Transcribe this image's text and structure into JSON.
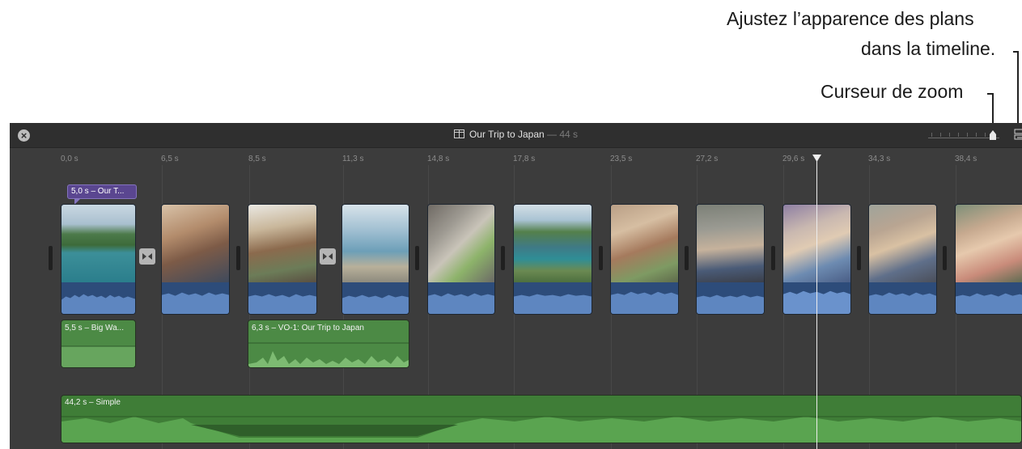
{
  "annotations": {
    "appearance_line1": "Ajustez l’apparence des plans",
    "appearance_line2": "dans la timeline.",
    "zoom": "Curseur de zoom"
  },
  "titlebar": {
    "project_title": "Our Trip to Japan",
    "duration": "— 44 s"
  },
  "ruler": [
    "0,0 s",
    "6,5 s",
    "8,5 s",
    "11,3 s",
    "14,8 s",
    "17,8 s",
    "23,5 s",
    "27,2 s",
    "29,6 s",
    "34,3 s",
    "38,4 s"
  ],
  "title_clip": {
    "label": "5,0 s – Our T..."
  },
  "audio_clips": {
    "sound_effect": "5,5 s – Big Wa...",
    "voiceover": "6,3 s – VO-1: Our Trip to Japan",
    "music": "44,2 s – Simple"
  },
  "colors": {
    "timeline_bg": "#3c3c3c",
    "video_audio": "#365887",
    "audio_green": "#4c8a45",
    "music_green": "#3f7d37",
    "title_purple": "#5a4690"
  },
  "icons": {
    "close": "close-icon",
    "project": "film-strip-icon",
    "zoom": "zoom-slider",
    "settings": "clip-appearance-icon",
    "transition": "transition-icon"
  }
}
